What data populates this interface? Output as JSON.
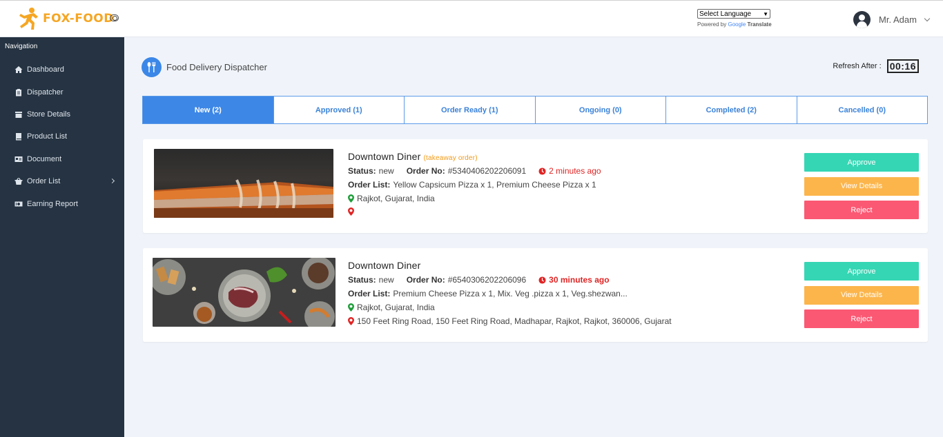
{
  "brand": {
    "name": "FOX-FOOD",
    "color": "#f5a623"
  },
  "language": {
    "select_label": "Select Language",
    "powered_by": "Powered by",
    "google": "Google",
    "translate": "Translate"
  },
  "user": {
    "name": "Mr. Adam"
  },
  "sidebar": {
    "title": "Navigation",
    "items": [
      {
        "label": "Dashboard",
        "icon": "home-icon"
      },
      {
        "label": "Dispatcher",
        "icon": "clipboard-icon"
      },
      {
        "label": "Store Details",
        "icon": "store-icon"
      },
      {
        "label": "Product List",
        "icon": "book-icon"
      },
      {
        "label": "Document",
        "icon": "id-card-icon"
      },
      {
        "label": "Order List",
        "icon": "basket-icon"
      },
      {
        "label": "Earning Report",
        "icon": "money-icon"
      }
    ]
  },
  "page": {
    "title": "Food Delivery Dispatcher",
    "refresh_label": "Refresh After :",
    "refresh_time": "00:16"
  },
  "tabs": [
    {
      "label": "New (2)",
      "active": true
    },
    {
      "label": "Approved (1)"
    },
    {
      "label": "Order Ready (1)"
    },
    {
      "label": "Ongoing (0)"
    },
    {
      "label": "Completed (2)"
    },
    {
      "label": "Cancelled (0)"
    }
  ],
  "orders": [
    {
      "store": "Downtown Diner",
      "tag": "(takeaway order)",
      "status_label": "Status:",
      "status": "new",
      "order_no_label": "Order No:",
      "order_no": "#5340406202206091",
      "time_ago": "2 minutes ago",
      "order_list_label": "Order List:",
      "order_list": "Yellow Capsicum Pizza x 1, Premium Cheese Pizza x 1",
      "pickup": "Rajkot, Gujarat, India",
      "dropoff": ""
    },
    {
      "store": "Downtown Diner",
      "tag": "",
      "status_label": "Status:",
      "status": "new",
      "order_no_label": "Order No:",
      "order_no": "#6540306202206096",
      "time_ago": "30 minutes ago",
      "order_list_label": "Order List:",
      "order_list": "Premium Cheese Pizza x 1, Mix. Veg .pizza x 1, Veg.shezwan...",
      "pickup": "Rajkot, Gujarat, India",
      "dropoff": "150 Feet Ring Road, 150 Feet Ring Road, Madhapar, Rajkot, Rajkot, 360006, Gujarat"
    }
  ],
  "actions": {
    "approve": "Approve",
    "details": "View Details",
    "reject": "Reject"
  },
  "colors": {
    "tab_active": "#3d87e6",
    "approve": "#35d6b4",
    "details": "#fcb54b",
    "reject": "#fb5873",
    "sidebar": "#253342"
  }
}
